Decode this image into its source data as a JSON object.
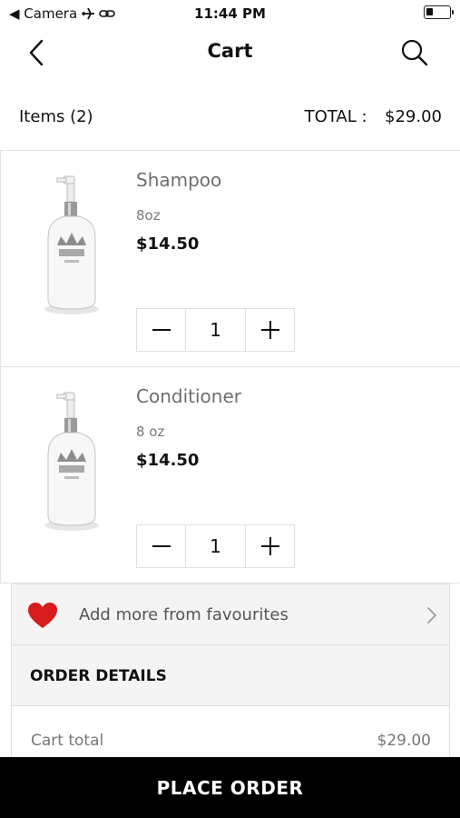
{
  "status_bar": {
    "back_app": "◀ Camera",
    "time": "11:44 PM",
    "battery_level": 0.3
  },
  "nav": {
    "title": "Cart",
    "back_icon": "chevron-left-icon",
    "search_icon": "search-icon"
  },
  "summary": {
    "items_label": "Items (2)",
    "total_label": "TOTAL :",
    "total_value": "$29.00"
  },
  "items": [
    {
      "name": "Shampoo",
      "size": "8oz",
      "price": "$14.50",
      "qty": "1"
    },
    {
      "name": "Conditioner",
      "size": "8 oz",
      "price": "$14.50",
      "qty": "1"
    }
  ],
  "favourites": {
    "label": "Add more from favourites",
    "icon": "heart-icon"
  },
  "order_details": {
    "title": "ORDER DETAILS",
    "cart_total_label": "Cart total",
    "cart_total_value": "$29.00"
  },
  "place_order": {
    "label": "PLACE ORDER"
  },
  "colors": {
    "heart": "#d81b1b",
    "button_bg": "#000000"
  }
}
